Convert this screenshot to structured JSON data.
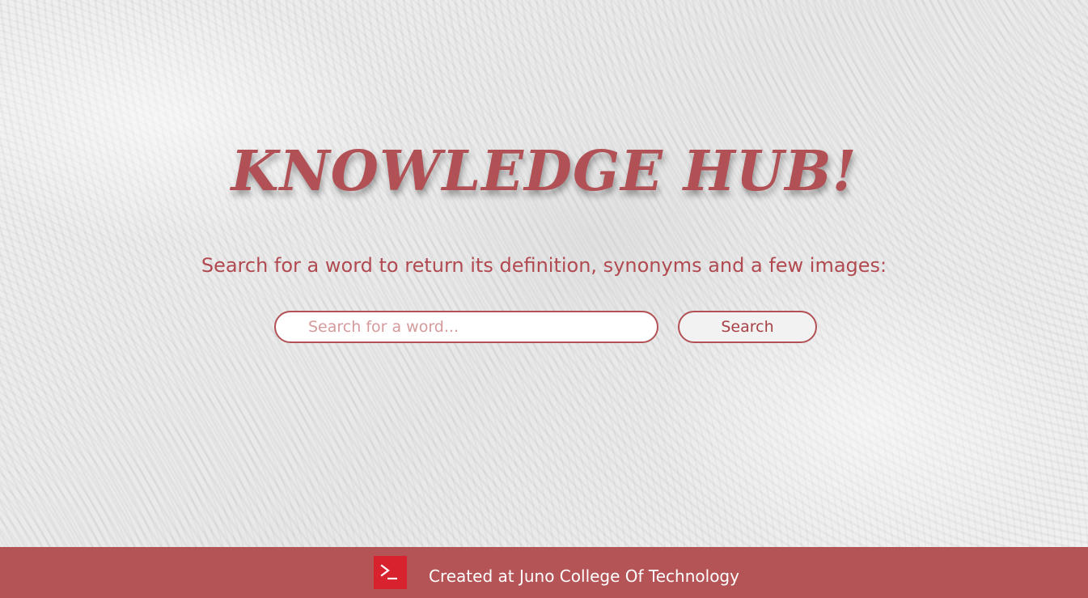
{
  "hero": {
    "title": "KNOWLEDGE HUB!",
    "subtitle": "Search for a word to return its definition, synonyms and a few images:"
  },
  "search": {
    "placeholder": "Search for a word...",
    "value": "",
    "button_label": "Search"
  },
  "footer": {
    "logo_icon": "terminal-prompt-icon",
    "text": "Created at Juno College Of Technology"
  },
  "colors": {
    "accent": "#b15155",
    "footer_bg": "#b45457",
    "logo_bg": "#d8222d",
    "footer_text": "#ffffff"
  }
}
